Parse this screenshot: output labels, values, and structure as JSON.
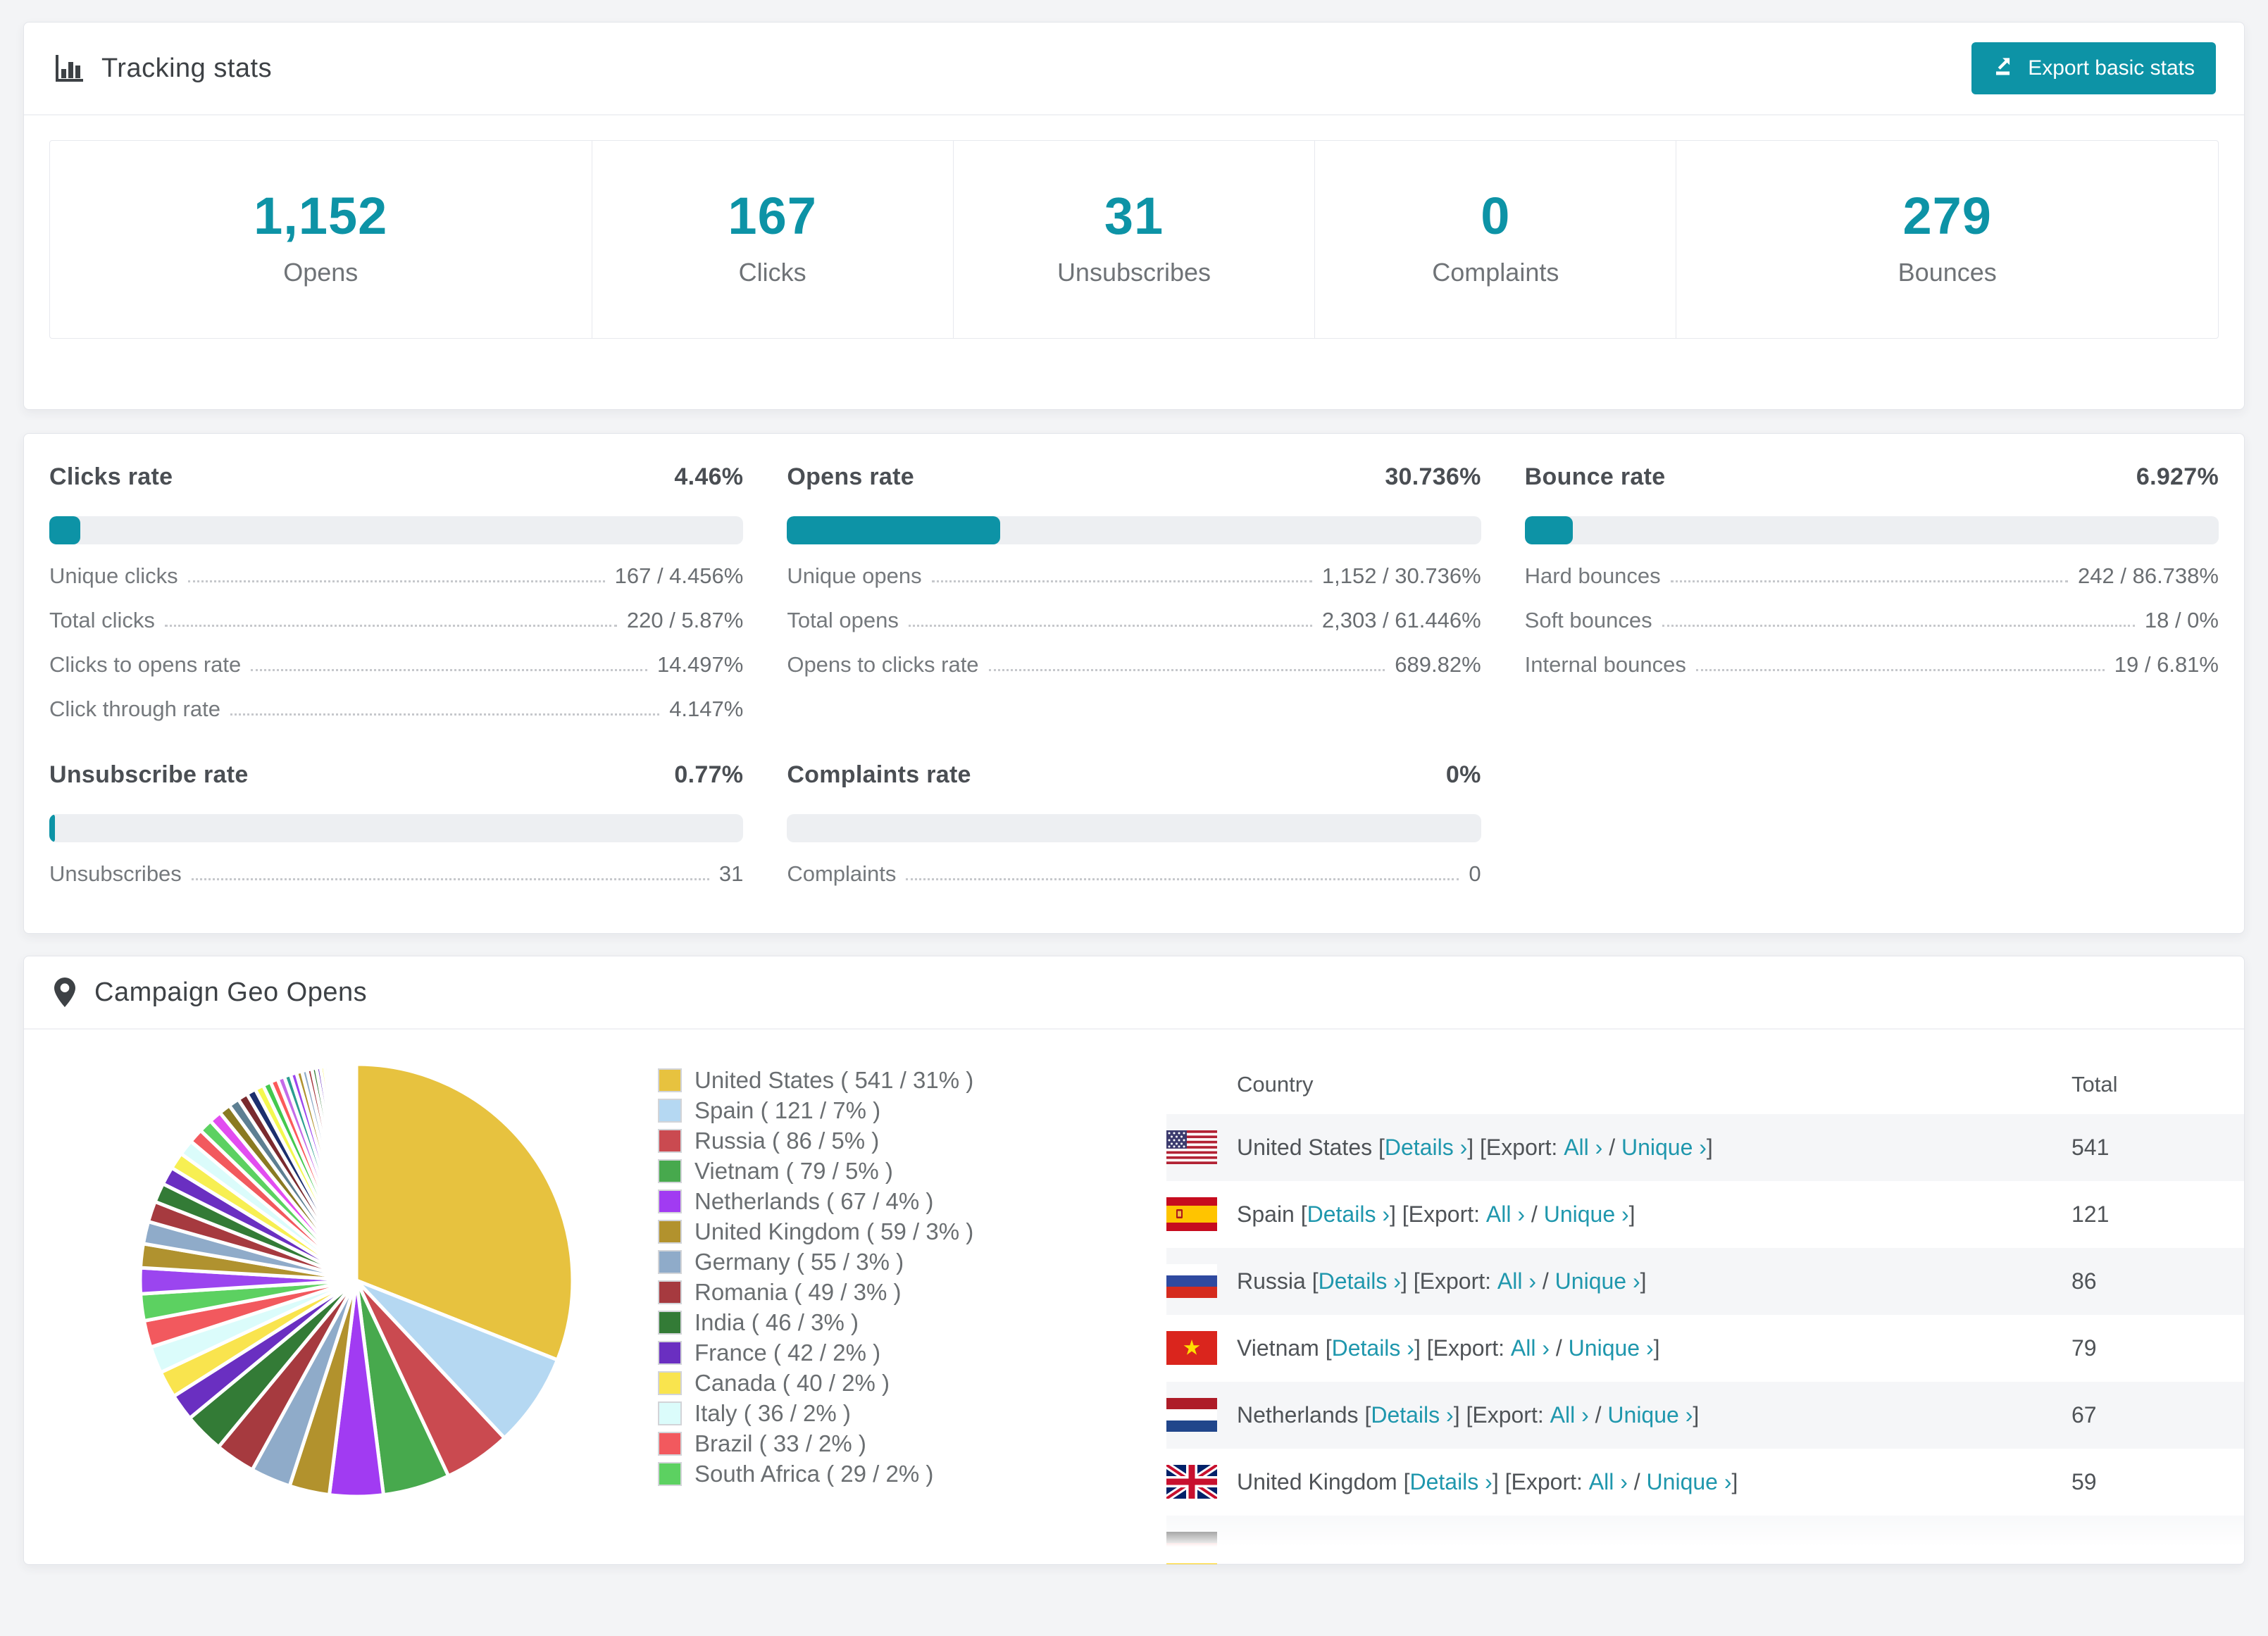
{
  "accent": "#0d93a6",
  "link_color": "#1f97ad",
  "tracking": {
    "title": "Tracking stats",
    "export_button": "Export basic stats",
    "stats": [
      {
        "value": "1,152",
        "label": "Opens"
      },
      {
        "value": "167",
        "label": "Clicks"
      },
      {
        "value": "31",
        "label": "Unsubscribes"
      },
      {
        "value": "0",
        "label": "Complaints"
      },
      {
        "value": "279",
        "label": "Bounces"
      }
    ]
  },
  "rates": {
    "panels": [
      {
        "title": "Clicks rate",
        "value": "4.46%",
        "percent": 4.46,
        "rows": [
          {
            "label": "Unique clicks",
            "value": "167 / 4.456%"
          },
          {
            "label": "Total clicks",
            "value": "220 / 5.87%"
          },
          {
            "label": "Clicks to opens rate",
            "value": "14.497%"
          },
          {
            "label": "Click through rate",
            "value": "4.147%"
          }
        ]
      },
      {
        "title": "Opens rate",
        "value": "30.736%",
        "percent": 30.736,
        "rows": [
          {
            "label": "Unique opens",
            "value": "1,152 / 30.736%"
          },
          {
            "label": "Total opens",
            "value": "2,303 / 61.446%"
          },
          {
            "label": "Opens to clicks rate",
            "value": "689.82%"
          }
        ]
      },
      {
        "title": "Bounce rate",
        "value": "6.927%",
        "percent": 6.927,
        "rows": [
          {
            "label": "Hard bounces",
            "value": "242 / 86.738%"
          },
          {
            "label": "Soft bounces",
            "value": "18 / 0%"
          },
          {
            "label": "Internal bounces",
            "value": "19 / 6.81%"
          }
        ]
      },
      {
        "title": "Unsubscribe rate",
        "value": "0.77%",
        "percent": 0.77,
        "rows": [
          {
            "label": "Unsubscribes",
            "value": "31"
          }
        ]
      },
      {
        "title": "Complaints rate",
        "value": "0%",
        "percent": 0,
        "rows": [
          {
            "label": "Complaints",
            "value": "0"
          }
        ]
      }
    ]
  },
  "geo": {
    "title": "Campaign Geo Opens",
    "chart_data": {
      "type": "pie",
      "title": "Campaign Geo Opens",
      "legend_position": "right",
      "start_angle_deg": -90,
      "direction": "clockwise",
      "series": [
        {
          "name": "United States",
          "value": 541,
          "pct": 31,
          "color": "#e7c23f"
        },
        {
          "name": "Spain",
          "value": 121,
          "pct": 7,
          "color": "#b5d8f2"
        },
        {
          "name": "Russia",
          "value": 86,
          "pct": 5,
          "color": "#ca4a50"
        },
        {
          "name": "Vietnam",
          "value": 79,
          "pct": 5,
          "color": "#47a94d"
        },
        {
          "name": "Netherlands",
          "value": 67,
          "pct": 4,
          "color": "#a13bf2"
        },
        {
          "name": "United Kingdom",
          "value": 59,
          "pct": 3,
          "color": "#b2922d"
        },
        {
          "name": "Germany",
          "value": 55,
          "pct": 3,
          "color": "#8fabc9"
        },
        {
          "name": "Romania",
          "value": 49,
          "pct": 3,
          "color": "#a63a3f"
        },
        {
          "name": "India",
          "value": 46,
          "pct": 3,
          "color": "#337b36"
        },
        {
          "name": "France",
          "value": 42,
          "pct": 2,
          "color": "#6a2fc1"
        },
        {
          "name": "Canada",
          "value": 40,
          "pct": 2,
          "color": "#f9e44e"
        },
        {
          "name": "Italy",
          "value": 36,
          "pct": 2,
          "color": "#dbfcfb"
        },
        {
          "name": "Brazil",
          "value": 33,
          "pct": 2,
          "color": "#f2595e"
        },
        {
          "name": "South Africa",
          "value": 29,
          "pct": 2,
          "color": "#5cd161"
        }
      ],
      "others": {
        "pct": 26,
        "note": "remaining smaller countries rendered as many thin unlabeled slices",
        "palette": [
          "#9b45ef",
          "#b0922f",
          "#8fabc9",
          "#a63a3f",
          "#337b36",
          "#6a2fc1",
          "#f7ef52",
          "#dbfcfb",
          "#f2595e",
          "#5cd161",
          "#e24df0",
          "#8a7a22",
          "#5d7f92",
          "#7a2a2e",
          "#1c2f6e",
          "#f4f84f",
          "#44c94e",
          "#fc5a5a",
          "#c46be8",
          "#2a9d8f"
        ]
      }
    },
    "table": {
      "columns": [
        "Country",
        "Total"
      ],
      "links": {
        "details": "Details ›",
        "export_prefix": "Export:",
        "all": "All ›",
        "separator": "/",
        "unique": "Unique ›"
      },
      "rows": [
        {
          "flag": "us",
          "country": "United States",
          "total": "541"
        },
        {
          "flag": "es",
          "country": "Spain",
          "total": "121"
        },
        {
          "flag": "ru",
          "country": "Russia",
          "total": "86"
        },
        {
          "flag": "vn",
          "country": "Vietnam",
          "total": "79"
        },
        {
          "flag": "nl",
          "country": "Netherlands",
          "total": "67"
        },
        {
          "flag": "gb",
          "country": "United Kingdom",
          "total": "59"
        },
        {
          "flag": "de",
          "country": "",
          "total": ""
        }
      ]
    }
  }
}
